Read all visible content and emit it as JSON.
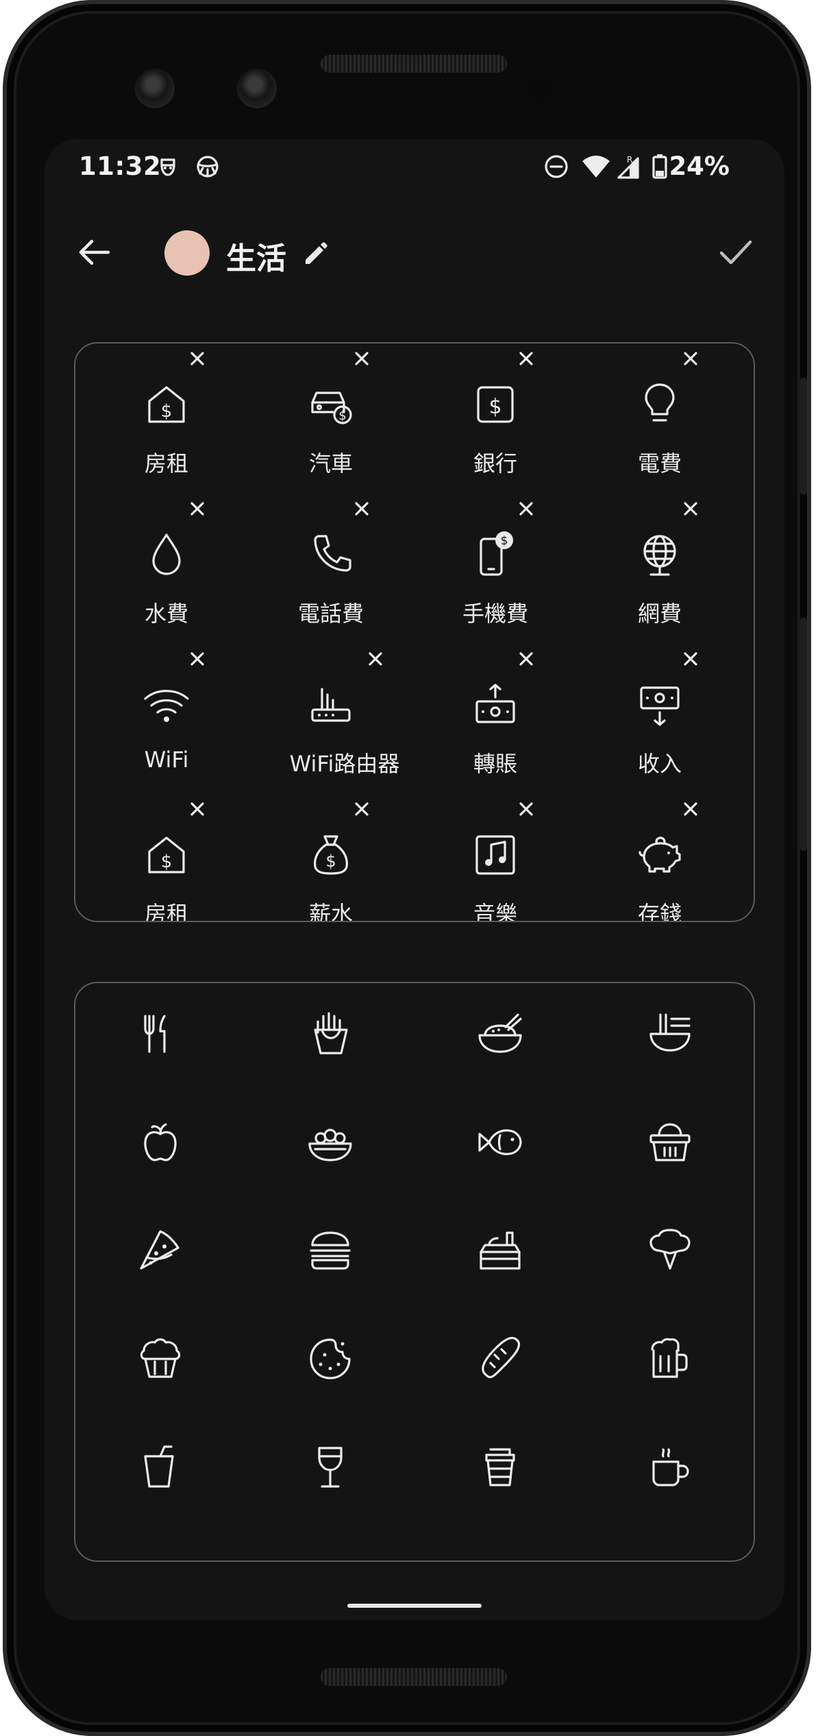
{
  "status_bar": {
    "time": "11:32",
    "battery": "24%",
    "icons": [
      "face-icon",
      "steering-wheel-icon",
      "do-not-disturb-icon",
      "wifi-icon",
      "signal-roaming-icon",
      "battery-icon"
    ]
  },
  "header": {
    "category_name": "生活",
    "category_color": "#e8c2b3"
  },
  "selected_items": [
    {
      "label": "房租",
      "icon": "rent-icon"
    },
    {
      "label": "汽車",
      "icon": "car-icon"
    },
    {
      "label": "銀行",
      "icon": "bank-icon"
    },
    {
      "label": "電費",
      "icon": "lightbulb-icon"
    },
    {
      "label": "水費",
      "icon": "water-drop-icon"
    },
    {
      "label": "電話費",
      "icon": "phone-icon"
    },
    {
      "label": "手機費",
      "icon": "mobile-dollar-icon"
    },
    {
      "label": "網費",
      "icon": "globe-icon"
    },
    {
      "label": "WiFi",
      "icon": "wifi-icon"
    },
    {
      "label": "WiFi路由器",
      "icon": "router-icon"
    },
    {
      "label": "轉賬",
      "icon": "transfer-icon"
    },
    {
      "label": "收入",
      "icon": "income-icon"
    },
    {
      "label": "房租",
      "icon": "rent-icon"
    },
    {
      "label": "薪水",
      "icon": "money-bag-icon"
    },
    {
      "label": "音樂",
      "icon": "music-icon"
    },
    {
      "label": "存錢",
      "icon": "piggy-bank-icon"
    }
  ],
  "icon_picker": [
    "cutlery-icon",
    "fries-icon",
    "rice-bowl-icon",
    "noodles-icon",
    "apple-icon",
    "salad-icon",
    "fish-icon",
    "basket-icon",
    "pizza-icon",
    "burger-icon",
    "lunchbox-icon",
    "broccoli-icon",
    "cupcake-icon",
    "cookie-icon",
    "bread-icon",
    "beer-icon",
    "cup-icon",
    "wine-glass-icon",
    "takeaway-coffee-icon",
    "coffee-mug-icon"
  ]
}
